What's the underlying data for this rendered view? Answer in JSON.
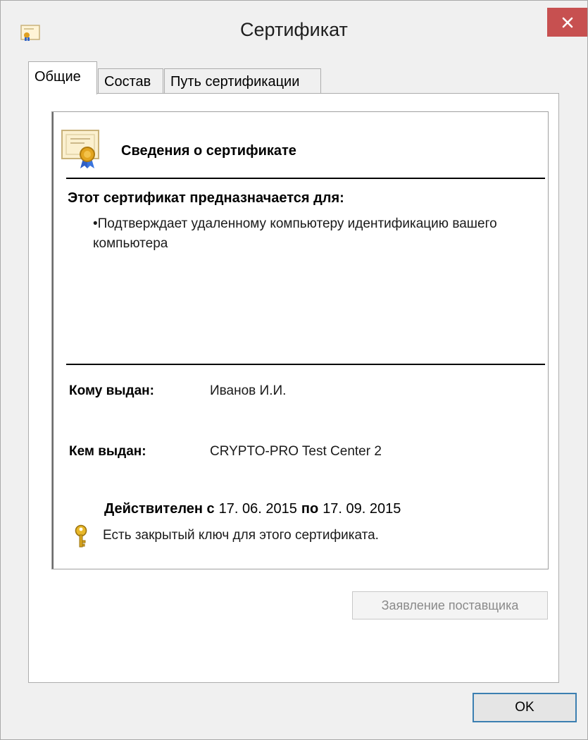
{
  "window": {
    "title": "Сертификат"
  },
  "tabs": [
    {
      "label": "Общие",
      "active": true
    },
    {
      "label": "Состав",
      "active": false
    },
    {
      "label": "Путь сертификации",
      "active": false
    }
  ],
  "certificate": {
    "heading": "Сведения о сертификате",
    "purpose_title": "Этот сертификат предназначается для:",
    "purpose_items": [
      "•Подтверждает удаленному компьютеру идентификацию вашего компьютера"
    ],
    "issued_to_label": "Кому выдан:",
    "issued_to_value": "Иванов И.И.",
    "issued_by_label": "Кем выдан:",
    "issued_by_value": "CRYPTO-PRO Test Center 2",
    "valid_from_label": "Действителен с",
    "valid_from": "17. 06. 2015",
    "valid_to_label": "по",
    "valid_to": "17. 09. 2015",
    "private_key_note": "Есть закрытый ключ для этого сертификата."
  },
  "buttons": {
    "issuer_statement": "Заявление поставщика",
    "ok": "OK"
  },
  "icons": {
    "app": "certificate-small-icon",
    "certificate": "certificate-ribbon-icon",
    "key": "key-icon",
    "close": "close-icon"
  },
  "colors": {
    "close_button": "#c75050",
    "ok_border": "#3c7fb1",
    "disabled_text": "#8a8a8a"
  }
}
